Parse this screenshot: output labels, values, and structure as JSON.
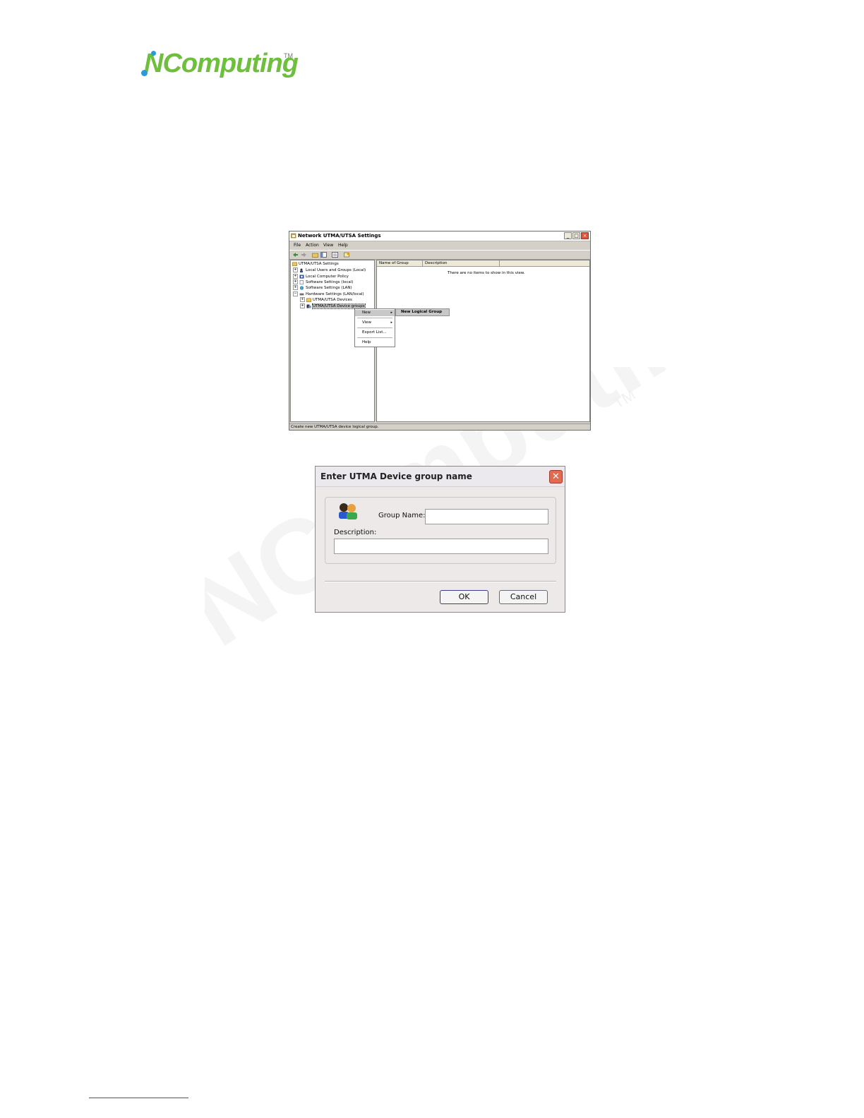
{
  "logo": {
    "text": "NComputing",
    "tm": "TM"
  },
  "watermark": {
    "text": "NComputing",
    "tm": "TM"
  },
  "mmc": {
    "title": "Network UTMA/UTSA Settings",
    "menu": [
      "File",
      "Action",
      "View",
      "Help"
    ],
    "tree": [
      {
        "label": "UTMA/UTSA Settings",
        "expander": ""
      },
      {
        "label": "Local Users and Groups (Local)",
        "expander": "+"
      },
      {
        "label": "Local Computer Policy",
        "expander": "+"
      },
      {
        "label": "Software Settings (local)",
        "expander": "+"
      },
      {
        "label": "Software Settings (LAN)",
        "expander": "+"
      },
      {
        "label": "Hardware Settings (LAN/local)",
        "expander": "−"
      },
      {
        "label": "UTMA/UTSA Devices",
        "expander": "+"
      },
      {
        "label": "UTMA/UTSA Device groups",
        "expander": "+"
      }
    ],
    "columns": [
      "Name of Group",
      "Description"
    ],
    "empty_message": "There are no items to show in this view.",
    "status": "Create  new UTMA/UTSA device logical group."
  },
  "context_menu": {
    "items": [
      "New",
      "View",
      "Export List...",
      "Help"
    ],
    "submenu": "New Logical Group"
  },
  "dialog": {
    "title": "Enter UTMA Device group name",
    "group_name_label": "Group Name:",
    "group_name_value": "",
    "description_label": "Description:",
    "description_value": "",
    "ok": "OK",
    "cancel": "Cancel"
  }
}
